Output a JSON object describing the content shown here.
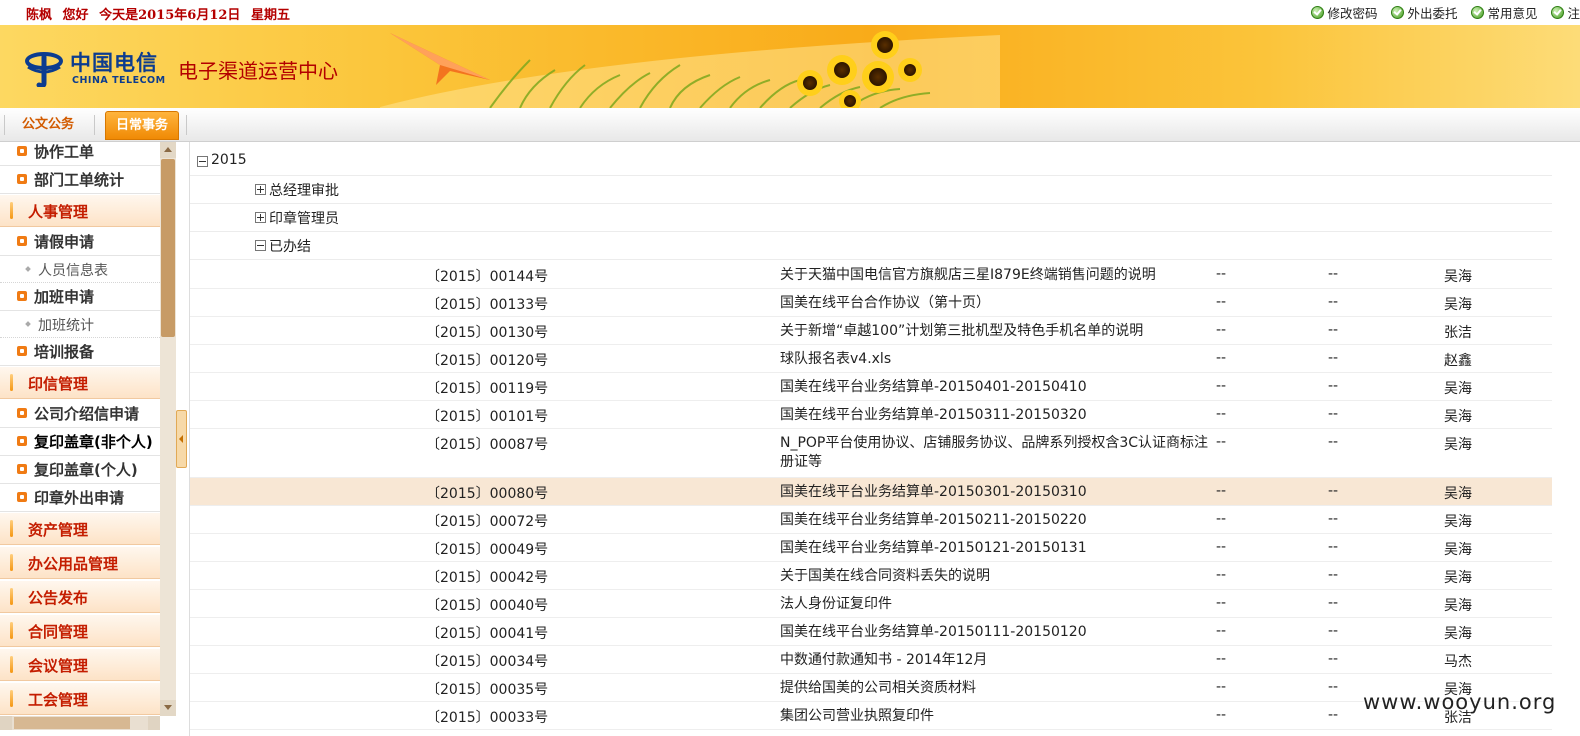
{
  "user_bar": {
    "user": "陈枫",
    "greeting": "您好",
    "date_text": "今天是2015年6月12日",
    "weekday": "星期五",
    "links": [
      "修改密码",
      "外出委托",
      "常用意见",
      "注"
    ]
  },
  "brand": {
    "logo_cn": "中国电信",
    "logo_en": "CHINA TELECOM",
    "site_title": "电子渠道运营中心"
  },
  "tabs": [
    {
      "label": "公文公务",
      "active": false
    },
    {
      "label": "日常事务",
      "active": true
    }
  ],
  "sidebar": {
    "items": [
      {
        "type": "item",
        "label": "协作工单"
      },
      {
        "type": "item",
        "label": "部门工单统计"
      },
      {
        "type": "category",
        "label": "人事管理"
      },
      {
        "type": "item",
        "label": "请假申请"
      },
      {
        "type": "sub",
        "label": "人员信息表"
      },
      {
        "type": "item",
        "label": "加班申请"
      },
      {
        "type": "sub",
        "label": "加班统计"
      },
      {
        "type": "item",
        "label": "培训报备"
      },
      {
        "type": "category",
        "label": "印信管理"
      },
      {
        "type": "item",
        "label": "公司介绍信申请"
      },
      {
        "type": "item",
        "label": "复印盖章(非个人)",
        "active": true
      },
      {
        "type": "item",
        "label": "复印盖章(个人)"
      },
      {
        "type": "item",
        "label": "印章外出申请"
      },
      {
        "type": "category",
        "label": "资产管理"
      },
      {
        "type": "category",
        "label": "办公用品管理"
      },
      {
        "type": "category",
        "label": "公告发布"
      },
      {
        "type": "category",
        "label": "合同管理"
      },
      {
        "type": "category",
        "label": "会议管理"
      },
      {
        "type": "category",
        "label": "工会管理"
      }
    ]
  },
  "tree": {
    "year": "2015",
    "nodes": [
      {
        "label": "总经理审批",
        "expanded": false
      },
      {
        "label": "印章管理员",
        "expanded": false
      },
      {
        "label": "已办结",
        "expanded": true
      }
    ]
  },
  "documents": [
    {
      "no": "〔2015〕00144号",
      "title": "关于天猫中国电信官方旗舰店三星I879E终端销售问题的说明",
      "c1": "--",
      "c2": "--",
      "person": "吴海"
    },
    {
      "no": "〔2015〕00133号",
      "title": "国美在线平台合作协议（第十页）",
      "c1": "--",
      "c2": "--",
      "person": "吴海"
    },
    {
      "no": "〔2015〕00130号",
      "title": "关于新增“卓越100”计划第三批机型及特色手机名单的说明",
      "c1": "--",
      "c2": "--",
      "person": "张洁"
    },
    {
      "no": "〔2015〕00120号",
      "title": "球队报名表v4.xls",
      "c1": "--",
      "c2": "--",
      "person": "赵鑫"
    },
    {
      "no": "〔2015〕00119号",
      "title": "国美在线平台业务结算单-20150401-20150410",
      "c1": "--",
      "c2": "--",
      "person": "吴海"
    },
    {
      "no": "〔2015〕00101号",
      "title": "国美在线平台业务结算单-20150311-20150320",
      "c1": "--",
      "c2": "--",
      "person": "吴海"
    },
    {
      "no": "〔2015〕00087号",
      "title": "N_POP平台使用协议、店铺服务协议、品牌系列授权含3C认证商标注册证等",
      "c1": "--",
      "c2": "--",
      "person": "吴海"
    },
    {
      "no": "〔2015〕00080号",
      "title": "国美在线平台业务结算单-20150301-20150310",
      "c1": "--",
      "c2": "--",
      "person": "吴海",
      "highlight": true
    },
    {
      "no": "〔2015〕00072号",
      "title": "国美在线平台业务结算单-20150211-20150220",
      "c1": "--",
      "c2": "--",
      "person": "吴海"
    },
    {
      "no": "〔2015〕00049号",
      "title": "国美在线平台业务结算单-20150121-20150131",
      "c1": "--",
      "c2": "--",
      "person": "吴海"
    },
    {
      "no": "〔2015〕00042号",
      "title": "关于国美在线合同资料丢失的说明",
      "c1": "--",
      "c2": "--",
      "person": "吴海"
    },
    {
      "no": "〔2015〕00040号",
      "title": "法人身份证复印件",
      "c1": "--",
      "c2": "--",
      "person": "吴海"
    },
    {
      "no": "〔2015〕00041号",
      "title": "国美在线平台业务结算单-20150111-20150120",
      "c1": "--",
      "c2": "--",
      "person": "吴海"
    },
    {
      "no": "〔2015〕00034号",
      "title": "中数通付款通知书 - 2014年12月",
      "c1": "--",
      "c2": "--",
      "person": "马杰"
    },
    {
      "no": "〔2015〕00035号",
      "title": "提供给国美的公司相关资质材料",
      "c1": "--",
      "c2": "--",
      "person": "吴海"
    },
    {
      "no": "〔2015〕00033号",
      "title": "集团公司营业执照复印件",
      "c1": "--",
      "c2": "--",
      "person": "张洁"
    }
  ],
  "watermark": "www.wooyun.org",
  "colors": {
    "brand_red": "#b40000",
    "accent_orange": "#f08a05",
    "highlight_row": "#f8e7d4"
  }
}
